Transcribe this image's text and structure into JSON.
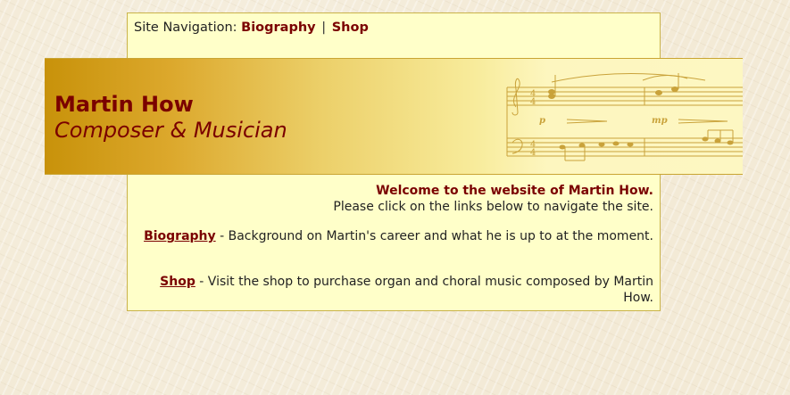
{
  "nav": {
    "prefix": "Site Navigation:",
    "links": [
      "Biography",
      "Shop"
    ],
    "separator": "|"
  },
  "banner": {
    "title": "Martin How",
    "subtitle": "Composer & Musician"
  },
  "welcome": {
    "heading": "Welcome to the website of Martin How.",
    "text": "Please click on the links below to navigate the site."
  },
  "sections": [
    {
      "link": "Biography",
      "text": " - Background on Martin's career and what he is up to at the moment."
    },
    {
      "link": "Shop",
      "text": " - Visit the shop to purchase organ and choral music composed by Martin How."
    }
  ],
  "colors": {
    "accent": "#7a0000",
    "panel": "#ffffc9",
    "banner_gold": "#c8920a"
  },
  "icons": {
    "score": "music-score-icon"
  }
}
